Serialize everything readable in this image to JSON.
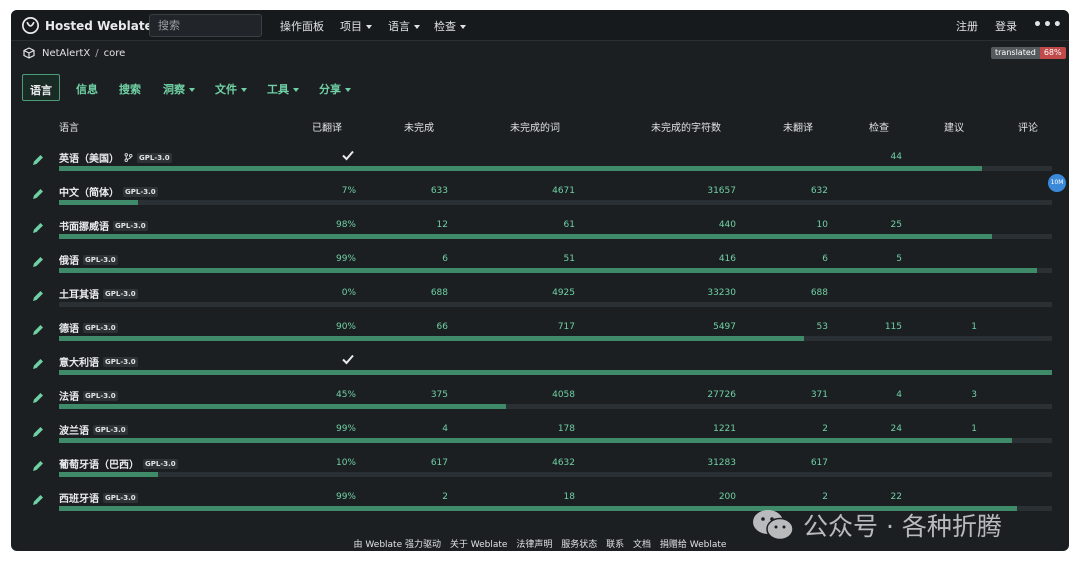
{
  "nav": {
    "brand": "Hosted Weblate",
    "search_placeholder": "搜索",
    "items": [
      {
        "label": "操作面板",
        "dropdown": false
      },
      {
        "label": "项目",
        "dropdown": true
      },
      {
        "label": "语言",
        "dropdown": true
      },
      {
        "label": "检查",
        "dropdown": true
      }
    ],
    "register": "注册",
    "login": "登录",
    "more": "•••"
  },
  "breadcrumb": {
    "project": "NetAlertX",
    "separator": "/",
    "component": "core"
  },
  "status_badge": {
    "label": "translated",
    "value": "68%"
  },
  "tabs": [
    "语言",
    "信息",
    "搜索",
    "洞察",
    "文件",
    "工具",
    "分享"
  ],
  "table": {
    "headers": [
      "语言",
      "已翻译",
      "未完成",
      "未完成的词",
      "未完成的字符数",
      "未翻译",
      "检查",
      "建议",
      "评论"
    ],
    "rows": [
      {
        "language": "英语（美国）",
        "license": "GPL-3.0",
        "source": true,
        "translated": "",
        "complete": true,
        "unfinished": "",
        "unfinished_words": "",
        "unfinished_chars": "",
        "untranslated": "",
        "checks": "44",
        "suggestions": "",
        "comments": "",
        "progress": 0.93
      },
      {
        "language": "中文（简体）",
        "license": "GPL-3.0",
        "source": false,
        "translated": "7%",
        "complete": false,
        "unfinished": "633",
        "unfinished_words": "4671",
        "unfinished_chars": "31657",
        "untranslated": "632",
        "checks": "",
        "suggestions": "",
        "comments": "",
        "progress": 0.08
      },
      {
        "language": "书面挪威语",
        "license": "GPL-3.0",
        "source": false,
        "translated": "98%",
        "complete": false,
        "unfinished": "12",
        "unfinished_words": "61",
        "unfinished_chars": "440",
        "untranslated": "10",
        "checks": "25",
        "suggestions": "",
        "comments": "",
        "progress": 0.94
      },
      {
        "language": "俄语",
        "license": "GPL-3.0",
        "source": false,
        "translated": "99%",
        "complete": false,
        "unfinished": "6",
        "unfinished_words": "51",
        "unfinished_chars": "416",
        "untranslated": "6",
        "checks": "5",
        "suggestions": "",
        "comments": "",
        "progress": 0.985
      },
      {
        "language": "土耳其语",
        "license": "GPL-3.0",
        "source": false,
        "translated": "0%",
        "complete": false,
        "unfinished": "688",
        "unfinished_words": "4925",
        "unfinished_chars": "33230",
        "untranslated": "688",
        "checks": "",
        "suggestions": "",
        "comments": "",
        "progress": 0.0
      },
      {
        "language": "德语",
        "license": "GPL-3.0",
        "source": false,
        "translated": "90%",
        "complete": false,
        "unfinished": "66",
        "unfinished_words": "717",
        "unfinished_chars": "5497",
        "untranslated": "53",
        "checks": "115",
        "suggestions": "1",
        "comments": "",
        "progress": 0.75
      },
      {
        "language": "意大利语",
        "license": "GPL-3.0",
        "source": false,
        "translated": "",
        "complete": true,
        "unfinished": "",
        "unfinished_words": "",
        "unfinished_chars": "",
        "untranslated": "",
        "checks": "",
        "suggestions": "",
        "comments": "",
        "progress": 1.0
      },
      {
        "language": "法语",
        "license": "GPL-3.0",
        "source": false,
        "translated": "45%",
        "complete": false,
        "unfinished": "375",
        "unfinished_words": "4058",
        "unfinished_chars": "27726",
        "untranslated": "371",
        "checks": "4",
        "suggestions": "3",
        "comments": "",
        "progress": 0.45
      },
      {
        "language": "波兰语",
        "license": "GPL-3.0",
        "source": false,
        "translated": "99%",
        "complete": false,
        "unfinished": "4",
        "unfinished_words": "178",
        "unfinished_chars": "1221",
        "untranslated": "2",
        "checks": "24",
        "suggestions": "1",
        "comments": "",
        "progress": 0.96
      },
      {
        "language": "葡萄牙语（巴西）",
        "license": "GPL-3.0",
        "source": false,
        "translated": "10%",
        "complete": false,
        "unfinished": "617",
        "unfinished_words": "4632",
        "unfinished_chars": "31283",
        "untranslated": "617",
        "checks": "",
        "suggestions": "",
        "comments": "",
        "progress": 0.1
      },
      {
        "language": "西班牙语",
        "license": "GPL-3.0",
        "source": false,
        "translated": "99%",
        "complete": false,
        "unfinished": "2",
        "unfinished_words": "18",
        "unfinished_chars": "200",
        "untranslated": "2",
        "checks": "22",
        "suggestions": "",
        "comments": "",
        "progress": 0.965
      }
    ]
  },
  "avatar_text": "10M",
  "footer": [
    "由 Weblate 强力驱动",
    "关于 Weblate",
    "法律声明",
    "服务状态",
    "联系",
    "文档",
    "捐赠给 Weblate"
  ],
  "watermark": "公众号 · 各种折腾",
  "colors": {
    "accent": "#6fd0a3",
    "progress": "#3f8a69",
    "background": "#1c1f22",
    "badge": "#c04a4a"
  },
  "icons": {
    "edit": "pencil-icon",
    "complete": "check-icon",
    "source": "fork-icon",
    "logo": "weblate-logo-icon"
  }
}
